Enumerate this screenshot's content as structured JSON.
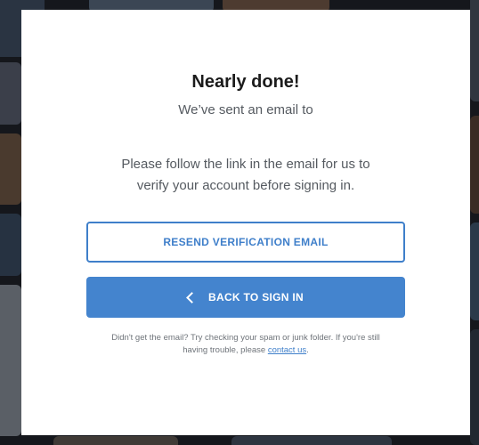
{
  "dialog": {
    "title": "Nearly done!",
    "sent_text": "We’ve sent an email to",
    "instructions_line1": "Please follow the link in the email for us to",
    "instructions_line2": "verify your account before signing in.",
    "resend_label": "RESEND VERIFICATION EMAIL",
    "back_label": "BACK TO SIGN IN",
    "help_text_line1": "Didn't get the email? Try checking your spam or junk folder. If you're still",
    "help_text_line2_prefix": "having trouble, please ",
    "help_link": "contact us",
    "help_text_suffix": "."
  },
  "colors": {
    "accent": "#4484ce",
    "outline": "#3f7fca",
    "title": "#1b1b1b",
    "body_text": "#555a60"
  },
  "icons": {
    "back": "chevron-left-icon"
  }
}
